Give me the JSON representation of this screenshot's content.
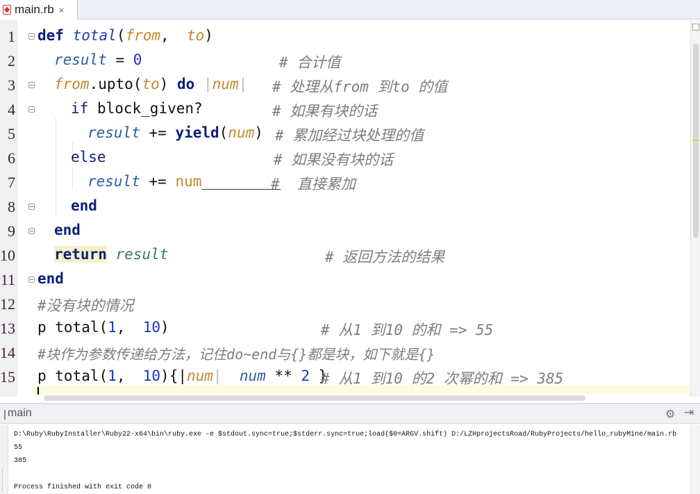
{
  "tab": {
    "label": "main.rb",
    "close": "×"
  },
  "code": {
    "lines": [
      {
        "no": "1"
      },
      {
        "no": "2"
      },
      {
        "no": "3"
      },
      {
        "no": "4"
      },
      {
        "no": "5"
      },
      {
        "no": "6"
      },
      {
        "no": "7"
      },
      {
        "no": "8"
      },
      {
        "no": "9"
      },
      {
        "no": "10"
      },
      {
        "no": "11"
      },
      {
        "no": "12"
      },
      {
        "no": "13"
      },
      {
        "no": "14"
      },
      {
        "no": "15"
      }
    ],
    "l1": {
      "def": "def",
      "name": "total",
      "open": "(",
      "p1": "from",
      "comma": ",  ",
      "p2": "to",
      "close": ")"
    },
    "l2": {
      "var": "result",
      "op": " = ",
      "num": "0",
      "comment": "# 合计值"
    },
    "l3": {
      "recv": "from",
      "call": ".upto(",
      "arg": "to",
      "close": ") ",
      "do": "do",
      "bar1": " |",
      "bp": "num",
      "bar2": "|",
      "comment": "# 处理从from 到to 的值"
    },
    "l4": {
      "if": "if",
      "cond": " block_given?",
      "comment": "# 如果有块的话"
    },
    "l5": {
      "var": "result",
      "op": " += ",
      "yield": "yield",
      "open": "(",
      "arg": "num",
      "close": ")",
      "comment": "# 累加经过块处理的值"
    },
    "l6": {
      "else": "else",
      "comment": "# 如果没有块的话"
    },
    "l7": {
      "var": "result",
      "op": " += ",
      "num": "num",
      "blank": "_________",
      "comment": "#  直接累加"
    },
    "l8": {
      "end": "end"
    },
    "l9": {
      "end": "end"
    },
    "l10": {
      "ret": "return",
      "var": "result",
      "comment": "# 返回方法的结果"
    },
    "l11": {
      "end": "end"
    },
    "l12": {
      "comment": "#没有块的情况"
    },
    "l13": {
      "p": "p total(",
      "a": "1",
      "comma": ",  ",
      "b": "10",
      "close": ")",
      "comment": "# 从1 到10 的和 => 55"
    },
    "l14": {
      "comment": "#块作为参数传递给方法，记住do~end与{}都是块，如下就是{}"
    },
    "l15": {
      "p": "p total(",
      "a": "1",
      "comma": ",  ",
      "b": "10",
      "brace": "){|",
      "bp": "num",
      "bar": "|  ",
      "var": "num",
      "op": " ** ",
      "exp": "2",
      "close": " }",
      "comment": "# 从1 到10 的2 次幂的和 => 385"
    }
  },
  "run": {
    "label": "main",
    "gear_icon": "⚙",
    "hide_icon": "⇥",
    "console": [
      "D:\\Ruby\\RubyInstaller\\Ruby22-x64\\bin\\ruby.exe -e $stdout.sync=true;$stderr.sync=true;load($0=ARGV.shift) D:/LZHprojectsRoad/RubyProjects/hello_rubyMine/main.rb",
      "55",
      "385",
      "",
      "Process finished with exit code 0"
    ]
  },
  "colors": {
    "keyword": "#0b1f7a",
    "param": "#c2882a",
    "variable": "#2c5ea3",
    "number": "#2030c0",
    "comment": "#7d7d7d"
  }
}
